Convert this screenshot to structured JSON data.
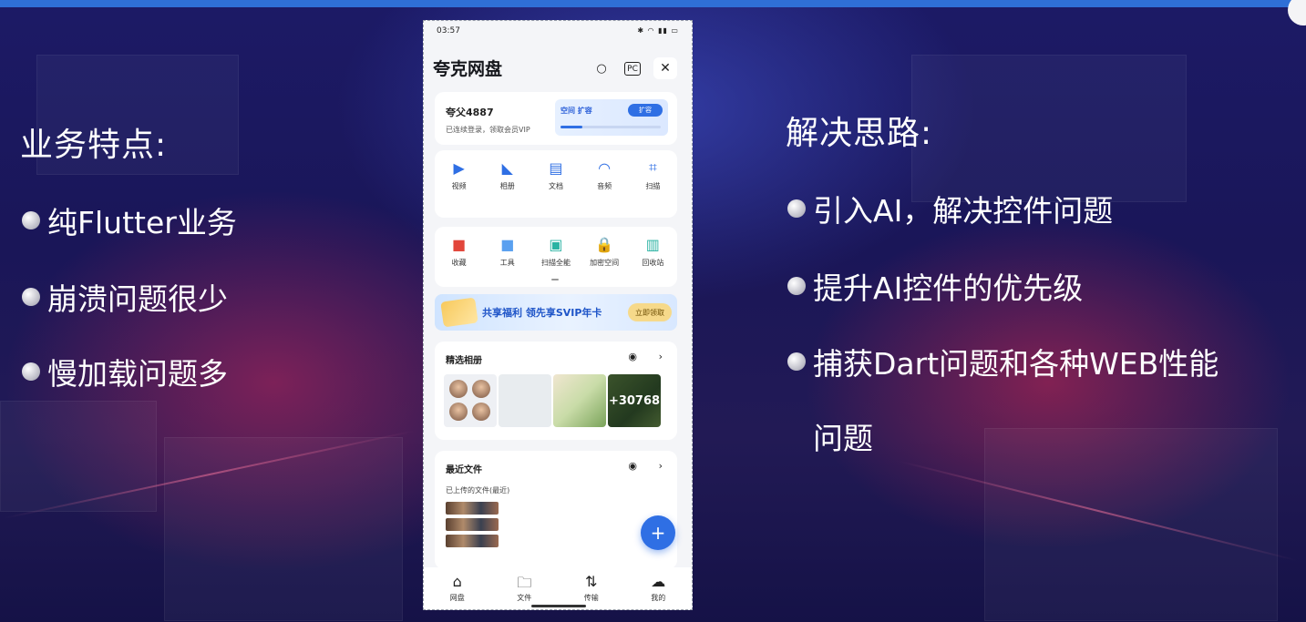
{
  "left_panel": {
    "title": "业务特点:",
    "bullets": [
      "纯Flutter业务",
      "崩溃问题很少",
      "慢加载问题多"
    ]
  },
  "right_panel": {
    "title": "解决思路:",
    "bullets": [
      "引入AI，解决控件问题",
      "提升AI控件的优先级",
      "捕获Dart问题和各种WEB性能"
    ],
    "bullet3_continuation": "问题"
  },
  "phone": {
    "status": {
      "time": "03:57",
      "system_icons": "✱ ◠ ▮▮ ▭"
    },
    "header": {
      "title": "夸克网盘"
    },
    "account": {
      "name": "夸父4887",
      "subtitle": "已连续登录，领取会员VIP",
      "storage_text": "空间 扩容",
      "storage_button": "扩容",
      "storage_used_fraction": 0.22
    },
    "tools_row1": [
      {
        "icon": "play-icon",
        "glyph": "▶",
        "label": "视频",
        "color": "#2f6fe4"
      },
      {
        "icon": "photo-icon",
        "glyph": "◣",
        "label": "相册",
        "color": "#2f6fe4"
      },
      {
        "icon": "document-icon",
        "glyph": "▤",
        "label": "文档",
        "color": "#2f6fe4"
      },
      {
        "icon": "headphones-icon",
        "glyph": "◠",
        "label": "音频",
        "color": "#2f6fe4"
      },
      {
        "icon": "scan-icon",
        "glyph": "⌗",
        "label": "扫描",
        "color": "#2f6fe4"
      }
    ],
    "tools_row2": [
      {
        "icon": "folder-red-icon",
        "glyph": "■",
        "label": "收藏",
        "color": "#e2463b"
      },
      {
        "icon": "box-icon",
        "glyph": "■",
        "label": "工具",
        "color": "#5aa0f0"
      },
      {
        "icon": "scan-doc-icon",
        "glyph": "▣",
        "label": "扫描全能",
        "color": "#2bb3a3"
      },
      {
        "icon": "lock-icon",
        "glyph": "🔒",
        "label": "加密空间",
        "color": "#3a7be8"
      },
      {
        "icon": "trash-icon",
        "glyph": "▥",
        "label": "回收站",
        "color": "#2bb3a3"
      }
    ],
    "banner": {
      "text": "共享福利 领先享SVIP年卡",
      "button": "立即领取"
    },
    "section1": {
      "title": "精选相册",
      "more_count": "+30768"
    },
    "section2": {
      "title": "最近文件",
      "subtitle": "已上传的文件(最近)"
    },
    "fab": "+",
    "tabs": [
      {
        "icon": "home-icon",
        "glyph": "⌂",
        "label": "网盘"
      },
      {
        "icon": "folder-icon",
        "glyph": "🗀",
        "label": "文件"
      },
      {
        "icon": "transfer-icon",
        "glyph": "⇅",
        "label": "传输"
      },
      {
        "icon": "cloud-icon",
        "glyph": "☁",
        "label": "我的"
      }
    ]
  }
}
